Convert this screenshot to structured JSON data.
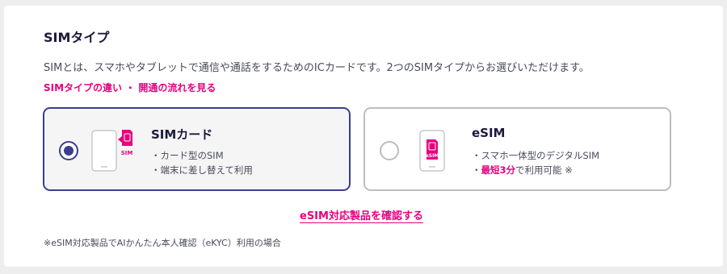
{
  "section": {
    "title": "SIMタイプ",
    "description": "SIMとは、スマホやタブレットで通信や通話をするためのICカードです。2つのSIMタイプからお選びいただけます。",
    "links": {
      "difference": "SIMタイプの違い",
      "separator": " ・ ",
      "flow": "開通の流れを見る"
    }
  },
  "options": {
    "sim": {
      "title": "SIMカード",
      "selected": true,
      "icon_label": "SIM",
      "features": [
        "・カード型のSIM",
        "・端末に差し替えて利用"
      ]
    },
    "esim": {
      "title": "eSIM",
      "selected": false,
      "icon_label": "eSIM",
      "feature1": "・スマホ一体型のデジタルSIM",
      "feature2_prefix": "・",
      "feature2_highlight": "最短3分",
      "feature2_suffix": "で利用可能 ※"
    }
  },
  "esim_products_link": "eSIM対応製品を確認する",
  "footnote": "※eSIM対応製品でAIかんたん本人確認（eKYC）利用の場合",
  "colors": {
    "accent": "#e6007e",
    "selected_border": "#3d3d8f",
    "unselected_border": "#bdbdbd"
  }
}
